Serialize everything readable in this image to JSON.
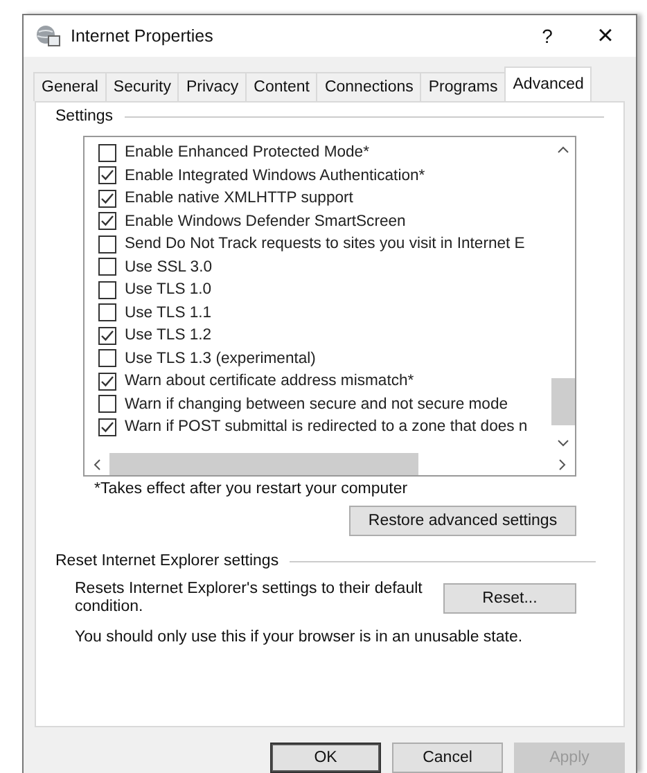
{
  "window": {
    "title": "Internet Properties",
    "help": "?",
    "close": "×"
  },
  "tabs": [
    {
      "label": "General",
      "selected": false
    },
    {
      "label": "Security",
      "selected": false
    },
    {
      "label": "Privacy",
      "selected": false
    },
    {
      "label": "Content",
      "selected": false
    },
    {
      "label": "Connections",
      "selected": false
    },
    {
      "label": "Programs",
      "selected": false
    },
    {
      "label": "Advanced",
      "selected": true
    }
  ],
  "settings": {
    "title": "Settings",
    "items": [
      {
        "label": "Enable Enhanced Protected Mode*",
        "checked": false
      },
      {
        "label": "Enable Integrated Windows Authentication*",
        "checked": true
      },
      {
        "label": "Enable native XMLHTTP support",
        "checked": true
      },
      {
        "label": "Enable Windows Defender SmartScreen",
        "checked": true
      },
      {
        "label": "Send Do Not Track requests to sites you visit in Internet E",
        "checked": false
      },
      {
        "label": "Use SSL 3.0",
        "checked": false
      },
      {
        "label": "Use TLS 1.0",
        "checked": false
      },
      {
        "label": "Use TLS 1.1",
        "checked": false
      },
      {
        "label": "Use TLS 1.2",
        "checked": true
      },
      {
        "label": "Use TLS 1.3 (experimental)",
        "checked": false
      },
      {
        "label": "Warn about certificate address mismatch*",
        "checked": true
      },
      {
        "label": "Warn if changing between secure and not secure mode",
        "checked": false
      },
      {
        "label": "Warn if POST submittal is redirected to a zone that does n",
        "checked": true
      }
    ],
    "note": "*Takes effect after you restart your computer",
    "restore_button": "Restore advanced settings"
  },
  "reset": {
    "title": "Reset Internet Explorer settings",
    "description": "Resets Internet Explorer's settings to their default condition.",
    "button": "Reset...",
    "warning": "You should only use this if your browser is in an unusable state."
  },
  "buttons": [
    {
      "label": "OK",
      "default": true,
      "disabled": false
    },
    {
      "label": "Cancel",
      "default": false,
      "disabled": false
    },
    {
      "label": "Apply",
      "default": false,
      "disabled": true
    }
  ]
}
